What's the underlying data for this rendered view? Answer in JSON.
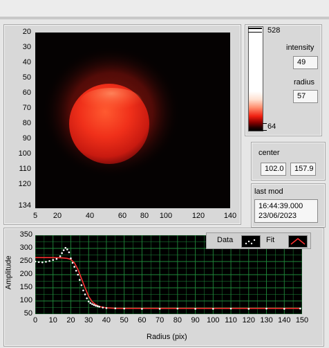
{
  "image_panel": {
    "y_ticks": [
      "20",
      "30",
      "40",
      "50",
      "60",
      "70",
      "80",
      "90",
      "100",
      "110",
      "120",
      "134"
    ],
    "x_ticks": [
      "5",
      "20",
      "40",
      "60",
      "80",
      "100",
      "120",
      "140"
    ]
  },
  "colorbar": {
    "max": "528",
    "min": "64"
  },
  "intensity": {
    "label": "intensity",
    "value": "49"
  },
  "radius": {
    "label": "radius",
    "value": "57"
  },
  "center": {
    "label": "center",
    "x": "102.0",
    "y": "157.9"
  },
  "last_mod": {
    "label": "last mod",
    "time": "16:44:39.000",
    "date": "23/06/2023"
  },
  "legend": {
    "data_label": "Data",
    "fit_label": "Fit"
  },
  "colors": {
    "data": "#ffffff",
    "fit": "#ff3030",
    "grid": "#1f8a3a",
    "plot_bg": "#000000"
  },
  "chart_data": {
    "type": "scatter",
    "xlabel": "Radius (pix)",
    "ylabel": "Amplitude",
    "xlim": [
      0,
      150
    ],
    "ylim": [
      50,
      350
    ],
    "x_ticks": [
      "0",
      "10",
      "20",
      "30",
      "40",
      "50",
      "60",
      "70",
      "80",
      "90",
      "100",
      "110",
      "120",
      "130",
      "140",
      "150"
    ],
    "y_ticks": [
      "350",
      "300",
      "250",
      "200",
      "150",
      "100",
      "50"
    ],
    "grid": true,
    "legend_position": "top-right",
    "series": [
      {
        "name": "Data",
        "x": [
          0,
          2,
          4,
          6,
          8,
          10,
          12,
          14,
          15,
          16,
          17,
          18,
          19,
          20,
          21,
          22,
          23,
          24,
          25,
          26,
          27,
          28,
          29,
          30,
          31,
          32,
          33,
          34,
          35,
          36,
          38,
          40,
          45,
          50,
          60,
          70,
          80,
          90,
          100,
          110,
          120,
          130,
          140,
          149
        ],
        "y": [
          250,
          248,
          247,
          249,
          252,
          256,
          260,
          270,
          282,
          293,
          302,
          296,
          285,
          262,
          245,
          230,
          215,
          200,
          180,
          160,
          140,
          125,
          110,
          98,
          92,
          88,
          85,
          82,
          80,
          78,
          75,
          73,
          72,
          71,
          70,
          70,
          71,
          70,
          70,
          71,
          70,
          71,
          70,
          71
        ]
      },
      {
        "name": "Fit",
        "x": [
          0,
          5,
          10,
          15,
          18,
          20,
          22,
          24,
          26,
          28,
          30,
          32,
          34,
          36,
          38,
          40,
          45,
          50,
          60,
          80,
          100,
          120,
          140,
          149
        ],
        "y": [
          265,
          265,
          265,
          264,
          262,
          258,
          245,
          220,
          185,
          150,
          118,
          97,
          86,
          79,
          76,
          74,
          72,
          72,
          72,
          72,
          72,
          72,
          72,
          72
        ]
      }
    ]
  }
}
